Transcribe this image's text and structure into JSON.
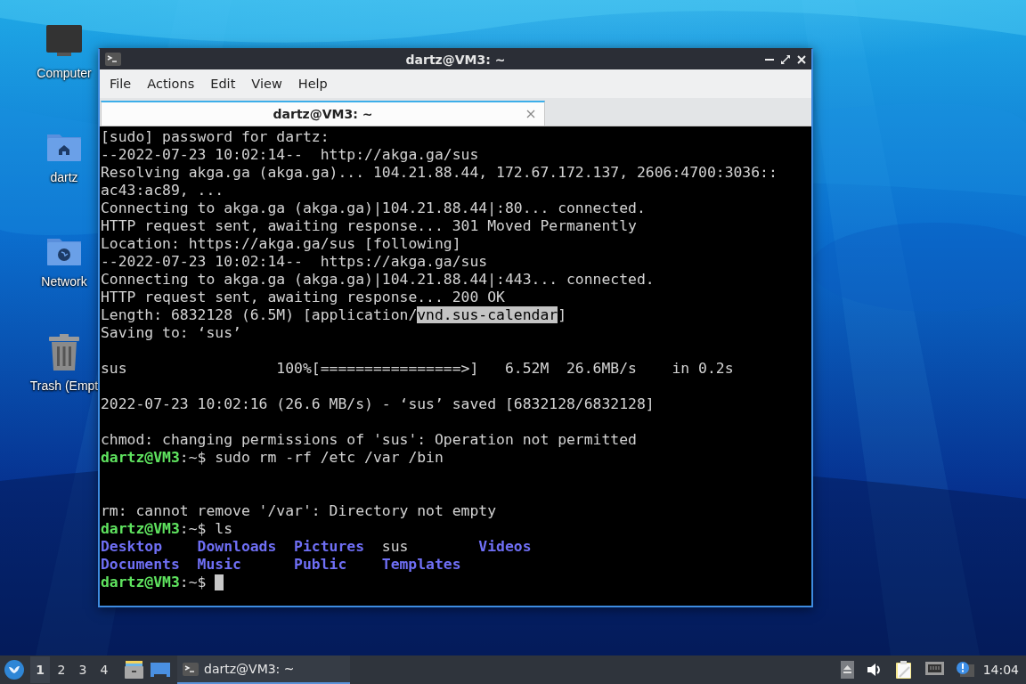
{
  "desktop": {
    "icons": [
      {
        "kind": "computer",
        "label": "Computer"
      },
      {
        "kind": "home",
        "label": "dartz"
      },
      {
        "kind": "network",
        "label": "Network"
      },
      {
        "kind": "trash",
        "label": "Trash (Empt"
      }
    ]
  },
  "window": {
    "title": "dartz@VM3: ~",
    "menu": [
      "File",
      "Actions",
      "Edit",
      "View",
      "Help"
    ],
    "tabs": [
      {
        "label": "dartz@VM3: ~",
        "selected": true
      }
    ],
    "terminal": {
      "lines": [
        {
          "kind": "output",
          "text": "[sudo] password for dartz:"
        },
        {
          "kind": "output",
          "text": "--2022-07-23 10:02:14--  http://akga.ga/sus"
        },
        {
          "kind": "output",
          "text": "Resolving akga.ga (akga.ga)... 104.21.88.44, 172.67.172.137, 2606:4700:3036::"
        },
        {
          "kind": "output",
          "text": "ac43:ac89, ..."
        },
        {
          "kind": "output",
          "text": "Connecting to akga.ga (akga.ga)|104.21.88.44|:80... connected."
        },
        {
          "kind": "output",
          "text": "HTTP request sent, awaiting response... 301 Moved Permanently"
        },
        {
          "kind": "output",
          "text": "Location: https://akga.ga/sus [following]"
        },
        {
          "kind": "output",
          "text": "--2022-07-23 10:02:14--  https://akga.ga/sus"
        },
        {
          "kind": "output",
          "text": "Connecting to akga.ga (akga.ga)|104.21.88.44|:443... connected."
        },
        {
          "kind": "output",
          "text": "HTTP request sent, awaiting response... 200 OK"
        },
        {
          "kind": "mixed",
          "segments": [
            {
              "text": "Length: 6832128 (6.5M) [application/",
              "highlighted": false
            },
            {
              "text": "vnd.sus-calendar",
              "highlighted": true
            },
            {
              "text": "]",
              "highlighted": false
            }
          ]
        },
        {
          "kind": "output",
          "text": "Saving to: ‘sus’"
        },
        {
          "kind": "blank"
        },
        {
          "kind": "output",
          "text": "sus                 100%[================>]   6.52M  26.6MB/s    in 0.2s"
        },
        {
          "kind": "blank"
        },
        {
          "kind": "output",
          "text": "2022-07-23 10:02:16 (26.6 MB/s) - ‘sus’ saved [6832128/6832128]"
        },
        {
          "kind": "blank"
        },
        {
          "kind": "output",
          "text": "chmod: changing permissions of 'sus': Operation not permitted"
        },
        {
          "kind": "prompt",
          "user": "dartz@VM3",
          "rest": ":~$",
          "command": "sudo rm -rf /etc /var /bin",
          "cursor": false
        },
        {
          "kind": "blank"
        },
        {
          "kind": "blank"
        },
        {
          "kind": "output",
          "text": "rm: cannot remove '/var': Directory not empty"
        },
        {
          "kind": "prompt",
          "user": "dartz@VM3",
          "rest": ":~$",
          "command": "ls",
          "cursor": false
        },
        {
          "kind": "listing",
          "entries": [
            {
              "name": "Desktop",
              "kind": "dir"
            },
            {
              "name": "Downloads",
              "kind": "dir"
            },
            {
              "name": "Pictures",
              "kind": "dir"
            },
            {
              "name": "sus",
              "kind": "file"
            },
            {
              "name": "Videos",
              "kind": "dir"
            }
          ]
        },
        {
          "kind": "listing",
          "entries": [
            {
              "name": "Documents",
              "kind": "dir"
            },
            {
              "name": "Music",
              "kind": "dir"
            },
            {
              "name": "Public",
              "kind": "dir"
            },
            {
              "name": "Templates",
              "kind": "dir"
            }
          ]
        },
        {
          "kind": "prompt",
          "user": "dartz@VM3",
          "rest": ":~$",
          "cursor": true
        }
      ]
    }
  },
  "taskbar": {
    "workspaces": [
      {
        "label": "1",
        "selected": true
      },
      {
        "label": "2",
        "selected": false
      },
      {
        "label": "3",
        "selected": false
      },
      {
        "label": "4",
        "selected": false
      }
    ],
    "tasks": [
      {
        "label": "dartz@VM3: ~",
        "selected": true
      }
    ],
    "clock": "14:04"
  }
}
